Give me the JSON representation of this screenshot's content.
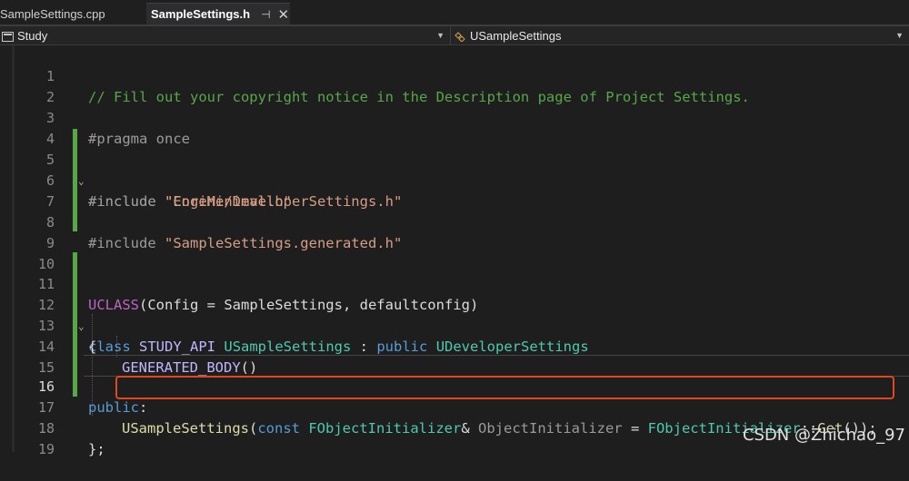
{
  "tabs": [
    {
      "label": "SampleSettings.cpp",
      "active": false
    },
    {
      "label": "SampleSettings.h",
      "active": true,
      "pin_icon": "pin-icon",
      "close_icon": "close-icon"
    }
  ],
  "nav": {
    "project": "Study",
    "scope": "USampleSettings"
  },
  "current_line": 16,
  "line_numbers": [
    "1",
    "2",
    "3",
    "4",
    "5",
    "6",
    "7",
    "8",
    "9",
    "10",
    "11",
    "12",
    "13",
    "14",
    "15",
    "16",
    "17",
    "18",
    "19"
  ],
  "code": {
    "l1": "// Fill out your copyright notice in the Description page of Project Settings.",
    "l3": "#pragma once",
    "l5_kw": "#include ",
    "l5_str": "\"CoreMinimal.h\"",
    "l6_kw": "#include ",
    "l6_str": "\"Engine/DeveloperSettings.h\"",
    "l8_kw": "#include ",
    "l8_str": "\"SampleSettings.generated.h\"",
    "l11_a": "UCLASS",
    "l11_b": "(Config = SampleSettings, defaultconfig)",
    "l12_class": "class",
    "l12_api": "STUDY_API",
    "l12_name": "USampleSettings",
    "l12_colon": " : ",
    "l12_public": "public",
    "l12_base": "UDeveloperSettings",
    "l13": "{",
    "l14": "GENERATED_BODY",
    "l14_paren": "()",
    "l16_kw": "public",
    "l16_colon": ":",
    "l17_name": "USampleSettings",
    "l17_p1": "(",
    "l17_const": "const",
    "l17_type": "FObjectInitializer",
    "l17_amp": "& ",
    "l17_param": "ObjectInitializer",
    "l17_eq": " = ",
    "l17_type2": "FObjectInitializer",
    "l17_scope": "::",
    "l17_get": "Get",
    "l17_end": "());",
    "l18": "};"
  },
  "watermark": "CSDN @Zhichao_97"
}
